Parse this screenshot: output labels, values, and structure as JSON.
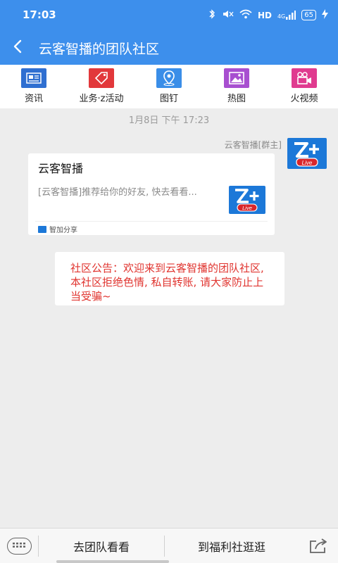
{
  "status_bar": {
    "time": "17:03",
    "network": "HD",
    "signal": "4G",
    "battery": "65"
  },
  "header": {
    "title": "云客智播的团队社区"
  },
  "toolbar": {
    "items": [
      {
        "label": "资讯",
        "icon": "news-icon",
        "color": "#2f6fd1"
      },
      {
        "label": "业务·z活动",
        "icon": "tag-icon",
        "color": "#e2383b"
      },
      {
        "label": "图钉",
        "icon": "location-pin-icon",
        "color": "#3a8ee8"
      },
      {
        "label": "热图",
        "icon": "image-icon",
        "color": "#a84fd0"
      },
      {
        "label": "火视频",
        "icon": "video-camera-icon",
        "color": "#e03b8f"
      }
    ]
  },
  "chat": {
    "timestamp": "1月8日 下午 17:23",
    "sender": "云客智播[群主]",
    "card": {
      "title": "云客智播",
      "description": "[云客智播]推荐给你的好友, 快去看看...",
      "source": "智加分享"
    },
    "notice": "社区公告：欢迎来到云客智播的团队社区,本社区拒绝色情, 私自转账, 请大家防止上当受骗~"
  },
  "bottom_bar": {
    "left_button": "去团队看看",
    "right_button": "到福利社逛逛"
  },
  "colors": {
    "header_bg": "#3d8fec",
    "notice_text": "#e0342f",
    "brand_blue": "#1c78d8"
  }
}
